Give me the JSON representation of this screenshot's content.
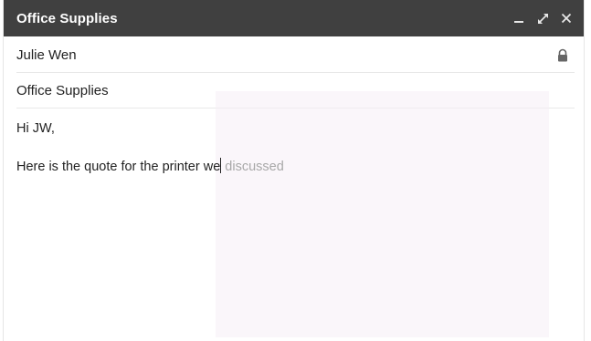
{
  "window": {
    "title": "Office Supplies",
    "controls": {
      "minimize_icon": "minimize-icon",
      "expand_icon": "expand-icon",
      "close_icon": "close-icon"
    }
  },
  "recipients": {
    "to": "Julie Wen",
    "lock_icon": "lock-icon"
  },
  "subject": "Office Supplies",
  "body": {
    "greeting": "Hi JW,",
    "typed_text": "Here is the quote for the printer we",
    "suggestion_text": "discussed"
  },
  "colors": {
    "titlebar": "#404040",
    "suggestion": "#a8a8a8"
  }
}
